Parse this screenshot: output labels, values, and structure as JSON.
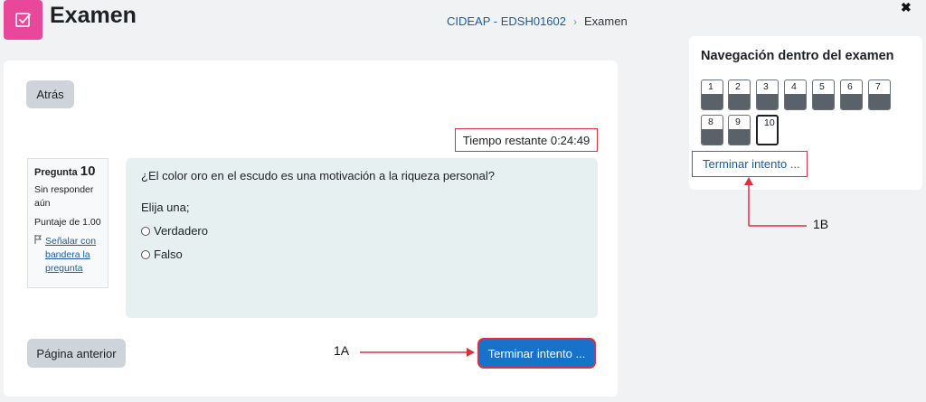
{
  "header": {
    "title": "Examen",
    "breadcrumb": [
      "CIDEAP - EDSH01602",
      "Examen"
    ]
  },
  "main": {
    "back_label": "Atrás",
    "timer_text": "Tiempo restante 0:24:49",
    "question_info": {
      "label": "Pregunta",
      "number": "10",
      "status": "Sin responder aún",
      "score": "Puntaje de 1.00",
      "flag_text": "Señalar con bandera la pregunta"
    },
    "question": {
      "text": "¿El color oro en el escudo es una motivación a la riqueza personal?",
      "prompt": "Elija una;",
      "options": [
        "Verdadero",
        "Falso"
      ]
    },
    "prev_label": "Página anterior",
    "finish_label": "Terminar intento ..."
  },
  "nav": {
    "close_glyph": "✖",
    "title": "Navegación dentro del examen",
    "questions": [
      "1",
      "2",
      "3",
      "4",
      "5",
      "6",
      "7",
      "8",
      "9",
      "10"
    ],
    "current": "10",
    "finish_link": "Terminar intento ..."
  },
  "annotations": {
    "a": "1A",
    "b": "1B"
  },
  "colors": {
    "accent_pink": "#e8479a",
    "primary_blue": "#1872c9",
    "highlight_red": "#d9323f",
    "link_blue": "#1a5c9e"
  }
}
